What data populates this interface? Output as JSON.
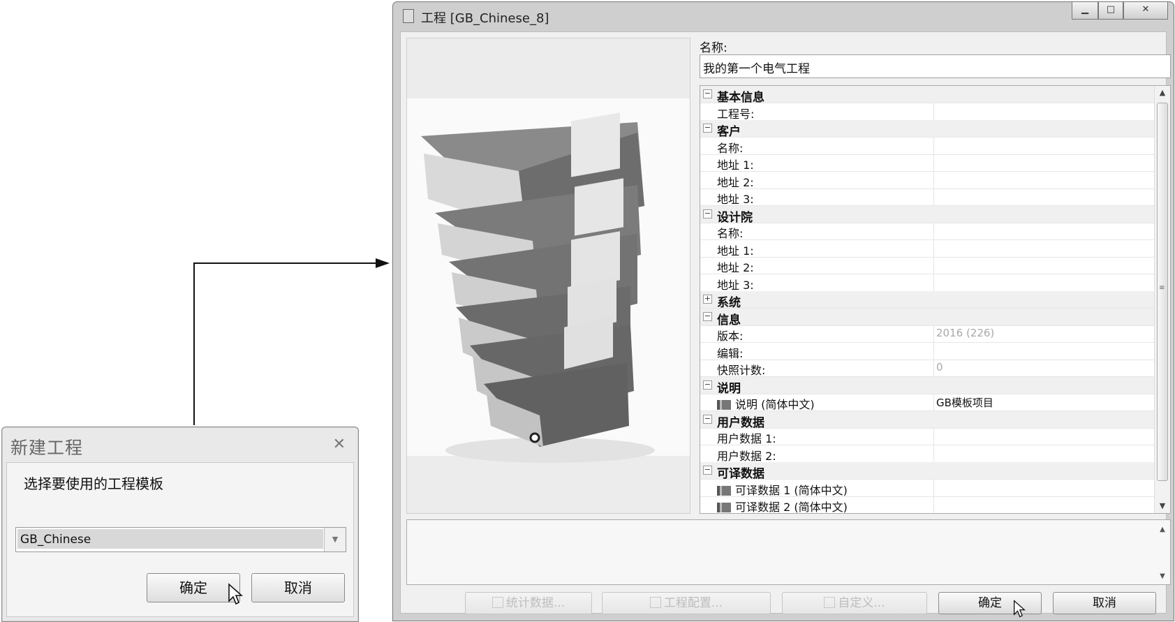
{
  "new_project_dialog": {
    "title": "新建工程",
    "close_glyph": "✕",
    "prompt": "选择要使用的工程模板",
    "template_value": "GB_Chinese",
    "ok_label": "确定",
    "cancel_label": "取消"
  },
  "project_dialog": {
    "title": "工程 [GB_Chinese_8]",
    "name_label": "名称:",
    "name_value": "我的第一个电气工程",
    "properties": [
      {
        "kind": "category",
        "expander": "−",
        "label": "基本信息"
      },
      {
        "kind": "property",
        "label": "工程号:",
        "value": ""
      },
      {
        "kind": "category",
        "expander": "−",
        "label": "客户"
      },
      {
        "kind": "property",
        "label": "名称:",
        "value": ""
      },
      {
        "kind": "property",
        "label": "地址 1:",
        "value": ""
      },
      {
        "kind": "property",
        "label": "地址 2:",
        "value": ""
      },
      {
        "kind": "property",
        "label": "地址 3:",
        "value": ""
      },
      {
        "kind": "category",
        "expander": "−",
        "label": "设计院"
      },
      {
        "kind": "property",
        "label": "名称:",
        "value": ""
      },
      {
        "kind": "property",
        "label": "地址 1:",
        "value": ""
      },
      {
        "kind": "property",
        "label": "地址 2:",
        "value": ""
      },
      {
        "kind": "property",
        "label": "地址 3:",
        "value": ""
      },
      {
        "kind": "category",
        "expander": "+",
        "label": "系统"
      },
      {
        "kind": "category",
        "expander": "−",
        "label": "信息"
      },
      {
        "kind": "property",
        "label": "版本:",
        "value": "2016 (226)",
        "dim": true
      },
      {
        "kind": "property",
        "label": "编辑:",
        "value": ""
      },
      {
        "kind": "property",
        "label": "快照计数:",
        "value": "0",
        "dim": true
      },
      {
        "kind": "category",
        "expander": "−",
        "label": "说明"
      },
      {
        "kind": "property",
        "label": "说明 (简体中文)",
        "value": "GB模板项目",
        "flag": true
      },
      {
        "kind": "category",
        "expander": "−",
        "label": "用户数据"
      },
      {
        "kind": "property",
        "label": "用户数据 1:",
        "value": ""
      },
      {
        "kind": "property",
        "label": "用户数据 2:",
        "value": ""
      },
      {
        "kind": "category",
        "expander": "−",
        "label": "可译数据"
      },
      {
        "kind": "property",
        "label": "可译数据 1 (简体中文)",
        "value": "",
        "flag": true
      },
      {
        "kind": "property",
        "label": "可译数据 2 (简体中文)",
        "value": "",
        "flag": true
      }
    ],
    "buttons": {
      "statistics": "统计数据...",
      "project_config": "工程配置...",
      "customize": "自定义...",
      "ok": "确定",
      "cancel": "取消"
    }
  },
  "colors": {
    "binder": "#6d6d6d",
    "binder_dark": "#4a4a4a",
    "label_strip": "#e8e8e8"
  }
}
